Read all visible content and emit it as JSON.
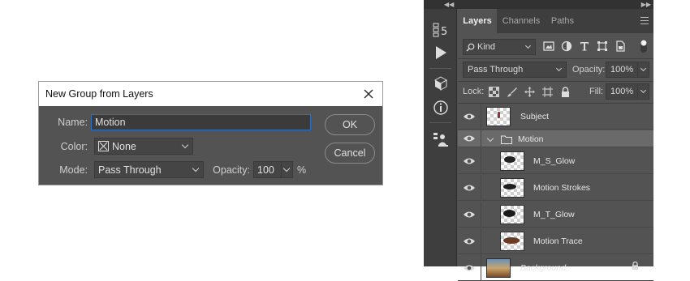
{
  "dialog": {
    "title": "New Group from Layers",
    "name_label": "Name:",
    "name_value": "Motion",
    "color_label": "Color:",
    "color_value": "None",
    "mode_label": "Mode:",
    "mode_value": "Pass Through",
    "opacity_label": "Opacity:",
    "opacity_value": "100",
    "opacity_unit": "%",
    "ok_label": "OK",
    "cancel_label": "Cancel"
  },
  "panel": {
    "tabs": [
      {
        "label": "Layers",
        "active": true
      },
      {
        "label": "Channels",
        "active": false
      },
      {
        "label": "Paths",
        "active": false
      }
    ],
    "filter": {
      "kind_label": "Kind"
    },
    "blend_mode": "Pass Through",
    "opacity_label": "Opacity:",
    "opacity_value": "100%",
    "lock_label": "Lock:",
    "fill_label": "Fill:",
    "fill_value": "100%",
    "layers": [
      {
        "name": "Subject",
        "type": "layer",
        "indent": false,
        "selected": false
      },
      {
        "name": "Motion",
        "type": "group",
        "indent": false,
        "selected": true,
        "expanded": true
      },
      {
        "name": "M_S_Glow",
        "type": "layer",
        "indent": true,
        "selected": false
      },
      {
        "name": "Motion Strokes",
        "type": "layer",
        "indent": true,
        "selected": false
      },
      {
        "name": "M_T_Glow",
        "type": "layer",
        "indent": true,
        "selected": false
      },
      {
        "name": "Motion Trace",
        "type": "layer",
        "indent": true,
        "selected": false
      },
      {
        "name": "Background",
        "type": "background",
        "indent": false,
        "selected": false,
        "locked": true
      }
    ]
  },
  "colors": {
    "panel_bg": "#535353",
    "focus_border": "#2f6fbd",
    "selected_row": "#6a6a6a"
  }
}
